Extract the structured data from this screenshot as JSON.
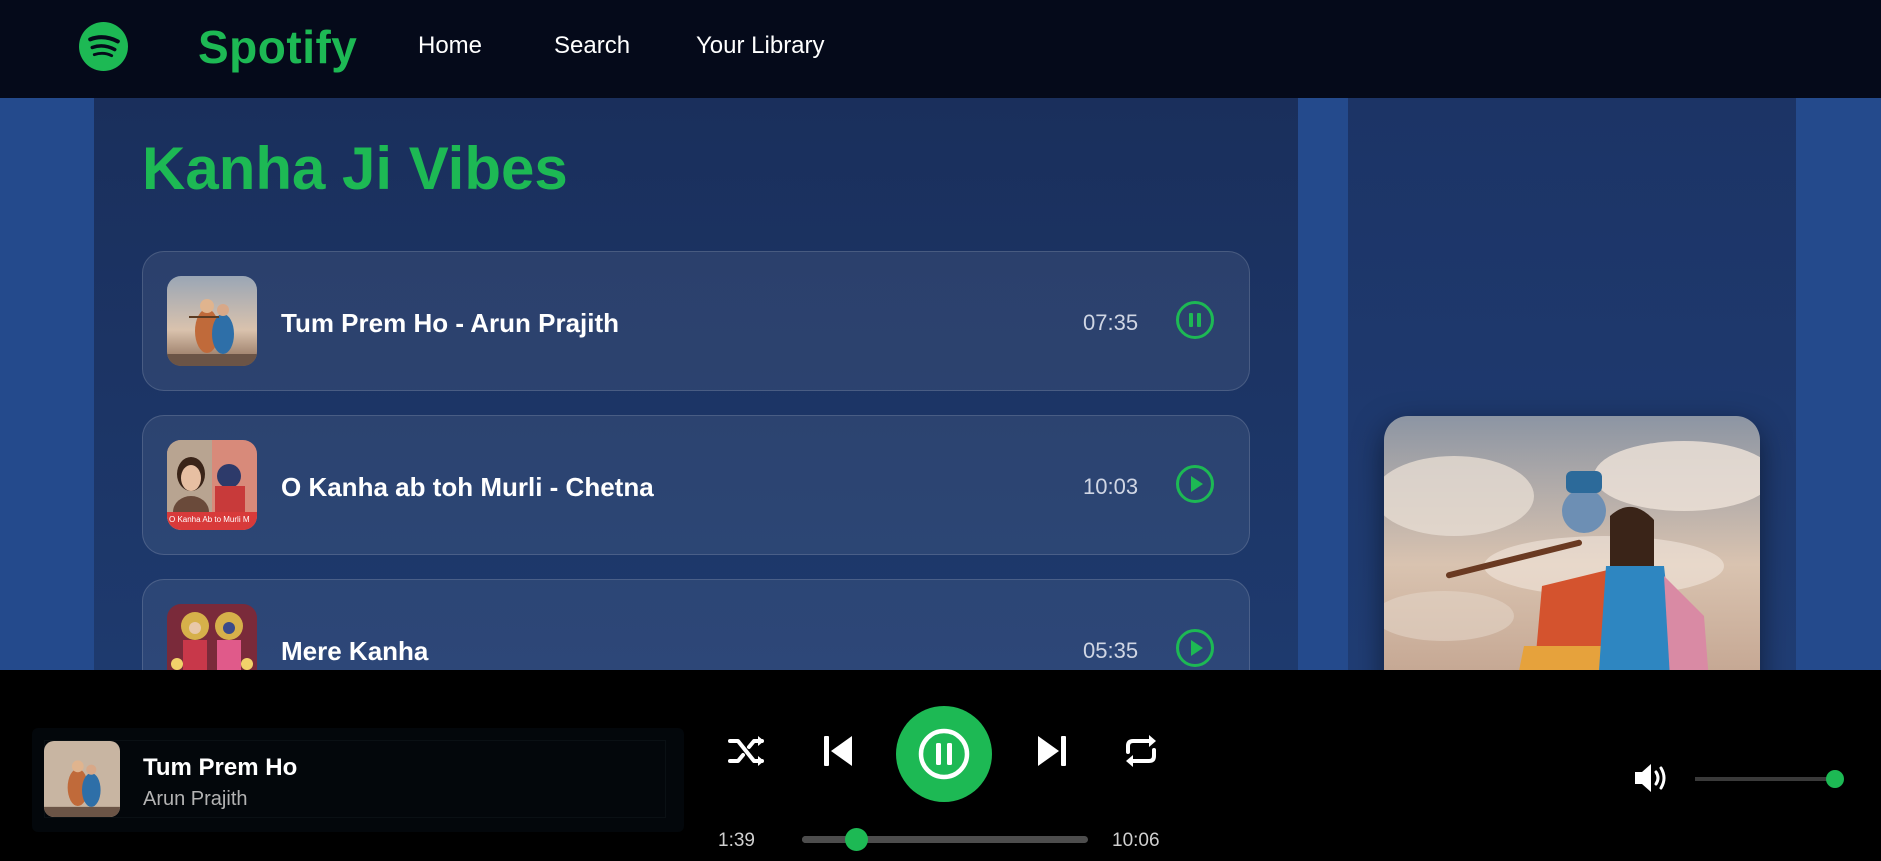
{
  "nav": {
    "brand": "Spotify",
    "links": [
      "Home",
      "Search",
      "Your Library"
    ]
  },
  "playlist": {
    "title": "Kanha Ji Vibes",
    "songs": [
      {
        "title": "Tum Prem Ho - Arun Prajith",
        "duration": "07:35",
        "state": "pause-icon"
      },
      {
        "title": "O Kanha ab toh Murli - Chetna",
        "duration": "10:03",
        "state": "play-icon",
        "thumb_caption": "O Kanha Ab to Murli M"
      },
      {
        "title": "Mere Kanha",
        "duration": "05:35",
        "state": "play-icon"
      }
    ]
  },
  "player": {
    "now_title": "Tum Prem Ho",
    "now_artist": "Arun Prajith",
    "time_current": "1:39",
    "time_total": "10:06",
    "progress_fraction": 0.19,
    "volume_fraction": 1.0
  },
  "colors": {
    "accent": "#1db954",
    "nav_bg": "#050a1a",
    "page_bg": "#244a8c",
    "player_bg": "#000000"
  }
}
